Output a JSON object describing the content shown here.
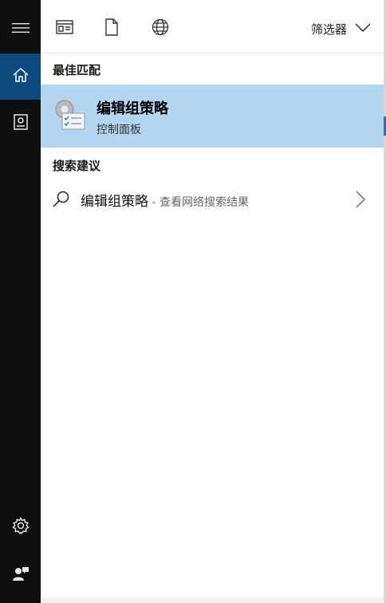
{
  "sidebar": {
    "items": [
      {
        "icon": "hamburger-menu-icon"
      },
      {
        "icon": "home-icon",
        "active": true
      },
      {
        "icon": "notebook-icon"
      },
      {
        "icon": "gear-icon"
      },
      {
        "icon": "feedback-person-icon"
      }
    ],
    "colors": {
      "background": "#0f0f0f",
      "active": "#0d4a7f"
    }
  },
  "toolbar": {
    "icons": [
      "apps-icon",
      "document-icon",
      "globe-icon"
    ],
    "filter_label": "筛选器",
    "filter_icon": "chevron-down-icon"
  },
  "best_match": {
    "title": "最佳匹配",
    "item": {
      "name": "编辑组策略",
      "subtitle": "控制面板",
      "icon": "group-policy-editor-icon",
      "highlight_color": "#b4d5f0"
    }
  },
  "suggestions": {
    "title": "搜索建议",
    "items": [
      {
        "text": "编辑组策略",
        "suffix": " - 查看网络搜索结果",
        "icon": "search-icon",
        "arrow": "chevron-right-icon"
      }
    ]
  }
}
